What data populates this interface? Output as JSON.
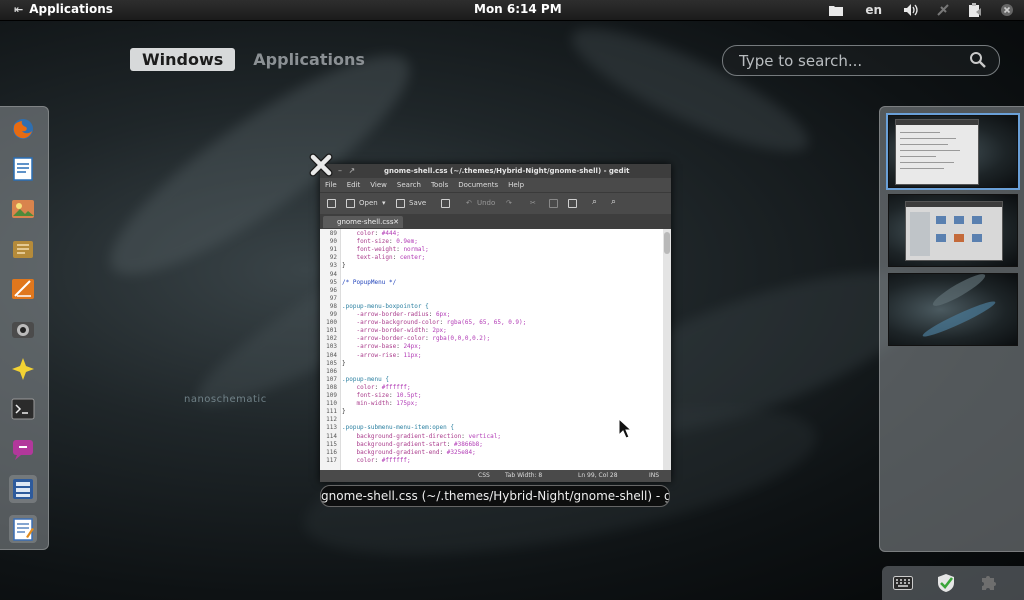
{
  "topbar": {
    "activities_label": "Applications",
    "clock": "Mon  6:14 PM",
    "keyboard_layout": "en"
  },
  "view_selector": {
    "windows_label": "Windows",
    "applications_label": "Applications"
  },
  "search": {
    "placeholder": "Type to search..."
  },
  "background": {
    "watermark": "nanoschematic"
  },
  "dash": {
    "items": [
      {
        "name": "firefox-icon",
        "color": "#e66b12"
      },
      {
        "name": "document-icon",
        "color": "#2a6fb5"
      },
      {
        "name": "image-viewer-icon",
        "color": "#d9844d"
      },
      {
        "name": "archive-icon",
        "color": "#b58b3a"
      },
      {
        "name": "presentation-icon",
        "color": "#e0771d"
      },
      {
        "name": "camera-icon",
        "color": "#6d6d6d"
      },
      {
        "name": "star-icon",
        "color": "#f3d233"
      },
      {
        "name": "terminal-icon",
        "color": "#2b2b2b"
      },
      {
        "name": "chat-icon",
        "color": "#b2389b"
      },
      {
        "name": "file-manager-icon",
        "color": "#2d5a9c"
      },
      {
        "name": "text-editor-icon",
        "color": "#3b6fb5"
      }
    ]
  },
  "window": {
    "title": "gnome-shell.css (~/.themes/Hybrid-Night/gnome-shell) - gedit",
    "caption": "gnome-shell.css (~/.themes/Hybrid-Night/gnome-shell) - g...",
    "menu": [
      "File",
      "Edit",
      "View",
      "Search",
      "Tools",
      "Documents",
      "Help"
    ],
    "toolbar": {
      "open": "Open",
      "save": "Save",
      "undo": "Undo"
    },
    "tab_label": "gnome-shell.css",
    "status": {
      "lang": "CSS",
      "tab_width": "Tab Width: 8",
      "position": "Ln 99, Col 28",
      "mode": "INS"
    },
    "lines": [
      {
        "n": "89",
        "t": "    color: #444;"
      },
      {
        "n": "90",
        "t": "    font-size: 0.9em;"
      },
      {
        "n": "91",
        "t": "    font-weight: normal;"
      },
      {
        "n": "92",
        "t": "    text-align: center;"
      },
      {
        "n": "93",
        "t": "}"
      },
      {
        "n": "94",
        "t": ""
      },
      {
        "n": "95",
        "t": "/* PopupMenu */"
      },
      {
        "n": "96",
        "t": ""
      },
      {
        "n": "97",
        "t": ""
      },
      {
        "n": "98",
        "t": ".popup-menu-boxpointor {"
      },
      {
        "n": "99",
        "t": "    -arrow-border-radius: 6px;"
      },
      {
        "n": "100",
        "t": "    -arrow-background-color: rgba(65, 65, 65, 0.9);"
      },
      {
        "n": "101",
        "t": "    -arrow-border-width: 2px;"
      },
      {
        "n": "102",
        "t": "    -arrow-border-color: rgba(0,0,0,0.2);"
      },
      {
        "n": "103",
        "t": "    -arrow-base: 24px;"
      },
      {
        "n": "104",
        "t": "    -arrow-rise: 11px;"
      },
      {
        "n": "105",
        "t": "}"
      },
      {
        "n": "106",
        "t": ""
      },
      {
        "n": "107",
        "t": ".popup-menu {"
      },
      {
        "n": "108",
        "t": "    color: #ffffff;"
      },
      {
        "n": "109",
        "t": "    font-size: 10.5pt;"
      },
      {
        "n": "110",
        "t": "    min-width: 175px;"
      },
      {
        "n": "111",
        "t": "}"
      },
      {
        "n": "112",
        "t": ""
      },
      {
        "n": "113",
        "t": ".popup-submenu-menu-item:open {"
      },
      {
        "n": "114",
        "t": "    background-gradient-direction: vertical;"
      },
      {
        "n": "115",
        "t": "    background-gradient-start: #3866b8;"
      },
      {
        "n": "116",
        "t": "    background-gradient-end: #325e84;"
      },
      {
        "n": "117",
        "t": "    color: #ffffff;"
      }
    ]
  },
  "colors": {
    "accent": "#6aa0d8",
    "panel": "#1b1b1b"
  }
}
